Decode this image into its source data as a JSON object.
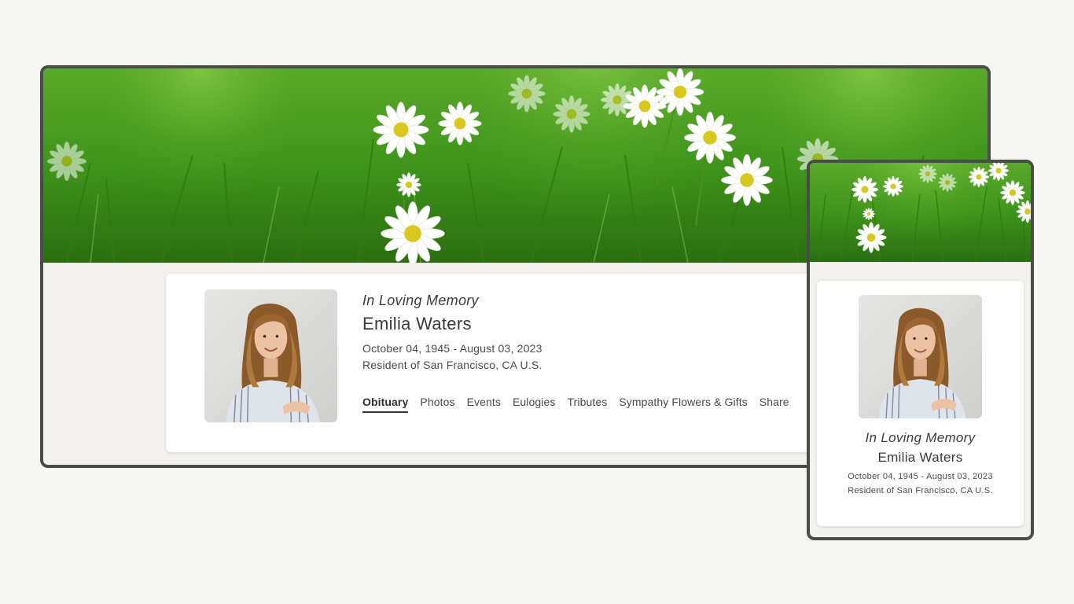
{
  "memorial": {
    "heading": "In Loving Memory",
    "name": "Emilia Waters",
    "dates": "October 04, 1945 - August 03, 2023",
    "residence": "Resident of San Francisco, CA U.S."
  },
  "tabs": [
    {
      "label": "Obituary",
      "active": true
    },
    {
      "label": "Photos",
      "active": false
    },
    {
      "label": "Events",
      "active": false
    },
    {
      "label": "Eulogies",
      "active": false
    },
    {
      "label": "Tributes",
      "active": false
    },
    {
      "label": "Sympathy Flowers & Gifts",
      "active": false
    },
    {
      "label": "Share",
      "active": false
    }
  ],
  "colors": {
    "page_background": "#f6f6f5",
    "frame_border": "#4a4c47",
    "frame_background": "#f2f1ee",
    "grass": "#3f9a1c"
  },
  "images": {
    "hero": "daisy-field",
    "portrait": "woman-portrait"
  }
}
